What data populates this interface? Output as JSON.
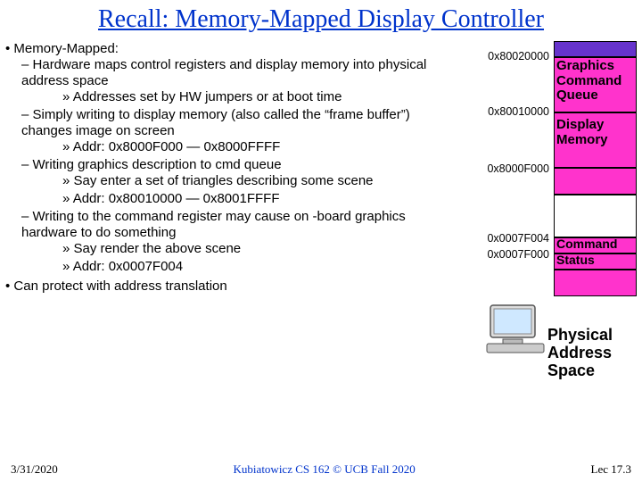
{
  "title": "Recall: Memory-Mapped Display Controller",
  "b1": "Memory-Mapped:",
  "b1_1": "Hardware maps control registers and display memory into physical address space",
  "b1_1_1": "Addresses set by HW jumpers or at boot time",
  "b1_2": "Simply writing to display memory (also called the “frame buffer”) changes image on screen",
  "b1_2_1": "Addr: 0x8000F000 — 0x8000FFFF",
  "b1_3": "Writing graphics description to cmd queue",
  "b1_3_1": "Say enter a set of triangles describing some scene",
  "b1_3_2": "Addr: 0x80010000 — 0x8001FFFF",
  "b1_4": "Writing to the command register may cause on -board graphics hardware to do something",
  "b1_4_1": "Say render the above scene",
  "b1_4_2": "Addr: 0x0007F004",
  "b2": "Can protect with address translation",
  "addr": {
    "a1": "0x80020000",
    "a2": "0x80010000",
    "a3": "0x8000F000",
    "a4": "0x0007F004",
    "a5": "0x0007F000"
  },
  "labels": {
    "gcq": "Graphics Command Queue",
    "dm": "Display Memory",
    "cmd": "Command",
    "sts": "Status",
    "pas": "Physical Address Space"
  },
  "footer": {
    "left": "3/31/2020",
    "center": "Kubiatowicz CS 162 © UCB Fall 2020",
    "right": "Lec 17.3"
  }
}
